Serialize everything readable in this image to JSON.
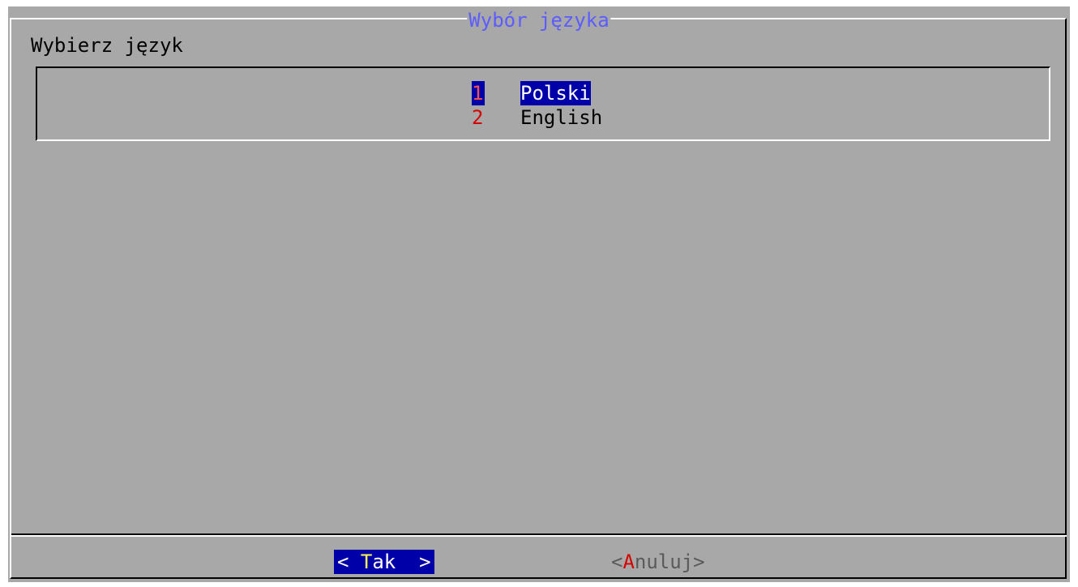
{
  "dialog": {
    "title": "Wybór języka",
    "prompt": "Wybierz język"
  },
  "menu": {
    "items": [
      {
        "key": "1",
        "label": "Polski",
        "selected": true
      },
      {
        "key": "2",
        "label": "English",
        "selected": false
      }
    ]
  },
  "buttons": {
    "ok": {
      "open": "< ",
      "hotkey": "T",
      "rest": "ak",
      "close": "  >"
    },
    "cancel": {
      "open": "<",
      "hotkey": "A",
      "rest": "nuluj",
      "close": ">"
    }
  },
  "colors": {
    "dialog_bg": "#a8a8a8",
    "title": "#5c5cff",
    "selection_bg": "#0000a8",
    "hotkey_red": "#d40000",
    "hotkey_yellow": "#ffff54"
  }
}
